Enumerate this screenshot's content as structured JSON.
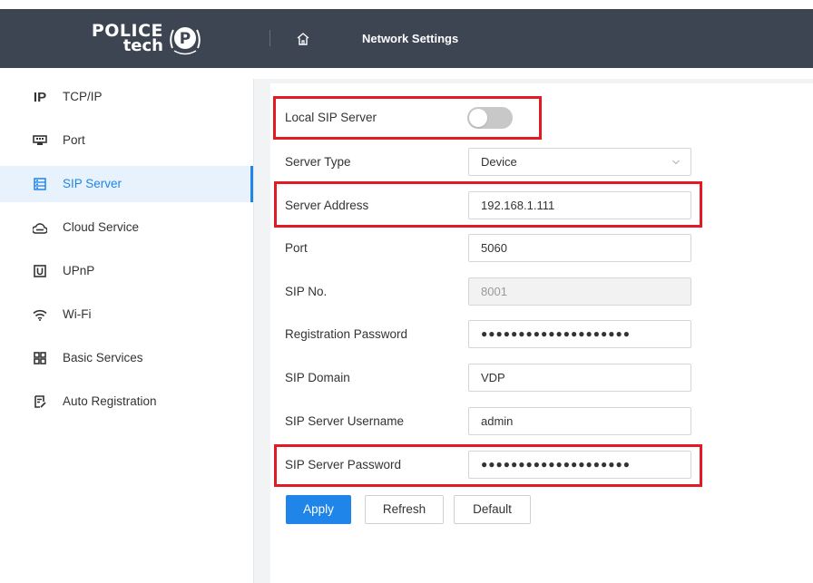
{
  "header": {
    "brand_word1": "POLICE",
    "brand_word2": "tech",
    "brand_badge": "P",
    "home_icon": "home-icon",
    "title": "Network Settings"
  },
  "sidebar": {
    "items": [
      {
        "label": "TCP/IP",
        "icon": "ip-icon",
        "active": false
      },
      {
        "label": "Port",
        "icon": "port-icon",
        "active": false
      },
      {
        "label": "SIP Server",
        "icon": "sip-server-icon",
        "active": true
      },
      {
        "label": "Cloud Service",
        "icon": "cloud-icon",
        "active": false
      },
      {
        "label": "UPnP",
        "icon": "upnp-icon",
        "active": false
      },
      {
        "label": "Wi-Fi",
        "icon": "wifi-icon",
        "active": false
      },
      {
        "label": "Basic Services",
        "icon": "basic-services-icon",
        "active": false
      },
      {
        "label": "Auto Registration",
        "icon": "auto-registration-icon",
        "active": false
      }
    ]
  },
  "form": {
    "local_sip_server": {
      "label": "Local SIP Server",
      "enabled": false
    },
    "server_type": {
      "label": "Server Type",
      "value": "Device"
    },
    "server_address": {
      "label": "Server Address",
      "value": "192.168.1.111"
    },
    "port": {
      "label": "Port",
      "value": "5060"
    },
    "sip_no": {
      "label": "SIP No.",
      "value": "8001"
    },
    "registration_password": {
      "label": "Registration Password",
      "value": "●●●●●●●●●●●●●●●●●●●●"
    },
    "sip_domain": {
      "label": "SIP Domain",
      "value": "VDP"
    },
    "sip_server_username": {
      "label": "SIP Server Username",
      "value": "admin"
    },
    "sip_server_password": {
      "label": "SIP Server Password",
      "value": "●●●●●●●●●●●●●●●●●●●●"
    }
  },
  "buttons": {
    "apply": "Apply",
    "refresh": "Refresh",
    "default": "Default"
  },
  "colors": {
    "topbar": "#3d4452",
    "accent": "#1f85e8",
    "highlight_box": "#e21a23",
    "active_item_bg": "#e8f2fd"
  }
}
